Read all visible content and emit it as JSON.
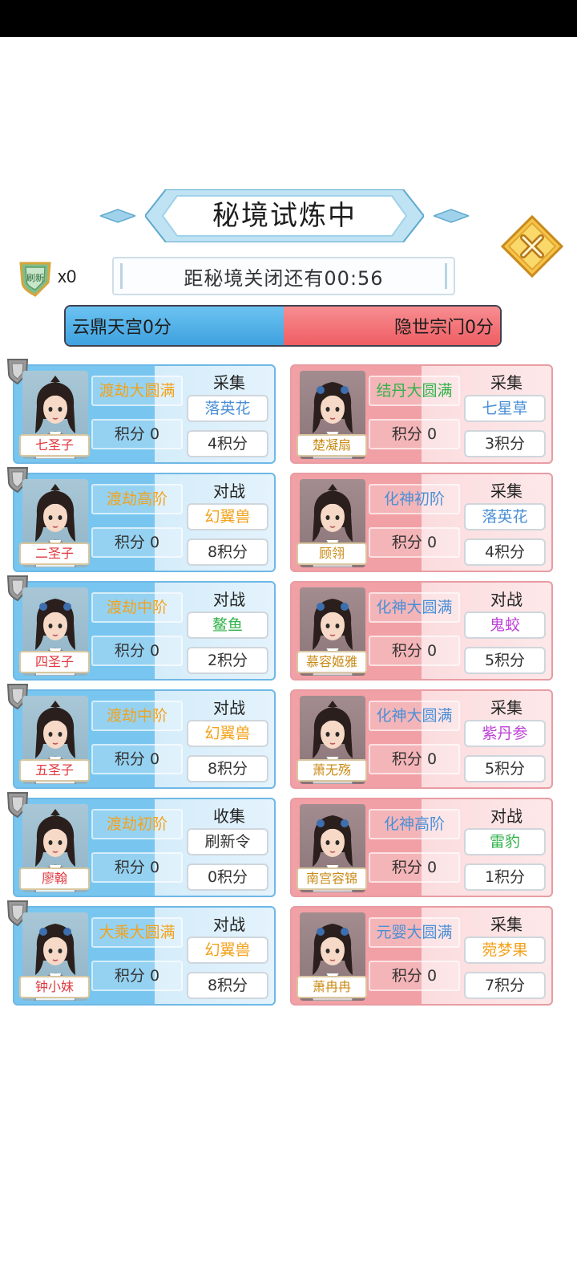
{
  "title": "秘境试炼中",
  "token": {
    "icon": "refresh-token-icon",
    "count": "x0",
    "icon_text": "刷新"
  },
  "timer": "距秘境关闭还有00:56",
  "teams": {
    "blue": {
      "label": "云鼎天宫0分",
      "color": "#4aa9e3"
    },
    "red": {
      "label": "隐世宗门0分",
      "color": "#f06b70"
    }
  },
  "colors": {
    "orange": "#f2a21b",
    "green": "#33b24a",
    "blue": "#4a8fd6",
    "purple": "#c040d8",
    "black": "#333333"
  },
  "blue_cards": [
    {
      "name": "七圣子",
      "realm": "渡劫大圆满",
      "realm_color": "orange",
      "points": "积分 0",
      "task": "采集",
      "target": "落英花",
      "target_color": "blue",
      "reward": "4积分"
    },
    {
      "name": "二圣子",
      "realm": "渡劫高阶",
      "realm_color": "orange",
      "points": "积分 0",
      "task": "对战",
      "target": "幻翼兽",
      "target_color": "orange",
      "reward": "8积分"
    },
    {
      "name": "四圣子",
      "realm": "渡劫中阶",
      "realm_color": "orange",
      "points": "积分 0",
      "task": "对战",
      "target": "鳌鱼",
      "target_color": "green",
      "reward": "2积分"
    },
    {
      "name": "五圣子",
      "realm": "渡劫中阶",
      "realm_color": "orange",
      "points": "积分 0",
      "task": "对战",
      "target": "幻翼兽",
      "target_color": "orange",
      "reward": "8积分"
    },
    {
      "name": "廖翰",
      "realm": "渡劫初阶",
      "realm_color": "orange",
      "points": "积分 0",
      "task": "收集",
      "target": "刷新令",
      "target_color": "black",
      "reward": "0积分"
    },
    {
      "name": "钟小妹",
      "realm": "大乘大圆满",
      "realm_color": "orange",
      "points": "积分 0",
      "task": "对战",
      "target": "幻翼兽",
      "target_color": "orange",
      "reward": "8积分"
    }
  ],
  "red_cards": [
    {
      "name": "楚凝扇",
      "realm": "结丹大圆满",
      "realm_color": "green",
      "points": "积分 0",
      "task": "采集",
      "target": "七星草",
      "target_color": "blue",
      "reward": "3积分"
    },
    {
      "name": "顾翎",
      "realm": "化神初阶",
      "realm_color": "blue",
      "points": "积分 0",
      "task": "采集",
      "target": "落英花",
      "target_color": "blue",
      "reward": "4积分"
    },
    {
      "name": "慕容姬雅",
      "realm": "化神大圆满",
      "realm_color": "blue",
      "points": "积分 0",
      "task": "对战",
      "target": "鬼蛟",
      "target_color": "purple",
      "reward": "5积分"
    },
    {
      "name": "萧无殇",
      "realm": "化神大圆满",
      "realm_color": "blue",
      "points": "积分 0",
      "task": "采集",
      "target": "紫丹参",
      "target_color": "purple",
      "reward": "5积分"
    },
    {
      "name": "南宫容锦",
      "realm": "化神高阶",
      "realm_color": "blue",
      "points": "积分 0",
      "task": "对战",
      "target": "雷豹",
      "target_color": "green",
      "reward": "1积分"
    },
    {
      "name": "萧冉冉",
      "realm": "元婴大圆满",
      "realm_color": "blue",
      "points": "积分 0",
      "task": "采集",
      "target": "菀梦果",
      "target_color": "orange",
      "reward": "7积分"
    }
  ]
}
